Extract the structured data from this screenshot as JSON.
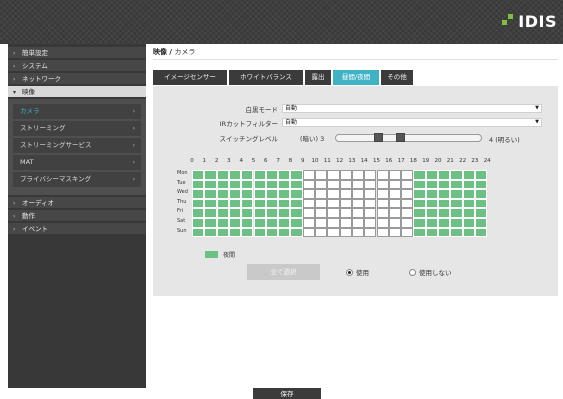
{
  "brand": {
    "logo_text": "IDIS"
  },
  "sidebar": {
    "items": [
      {
        "label": "簡単設定"
      },
      {
        "label": "システム"
      },
      {
        "label": "ネットワーク"
      },
      {
        "label": "映像"
      },
      {
        "label": "オーディオ"
      },
      {
        "label": "動作"
      },
      {
        "label": "イベント"
      }
    ],
    "submenu": [
      {
        "label": "カメラ"
      },
      {
        "label": "ストリーミング"
      },
      {
        "label": "ストリーミングサービス"
      },
      {
        "label": "MAT"
      },
      {
        "label": "プライバシーマスキング"
      }
    ]
  },
  "breadcrumb": {
    "section": "映像 / ",
    "current": "カメラ"
  },
  "tabs": [
    {
      "label": "イメージセンサー"
    },
    {
      "label": "ホワイトバランス"
    },
    {
      "label": "露出"
    },
    {
      "label": "昼間/夜間"
    },
    {
      "label": "その他"
    }
  ],
  "form": {
    "mode_label": "白黒モード",
    "mode_value": "自動",
    "ircut_label": "IRカットフィルター",
    "ircut_value": "自動",
    "switch_label": "スイッチングレベル",
    "dark_label": "(暗い) 3",
    "bright_label": "4 (明るい)",
    "switch_level_low": 3,
    "switch_level_high": 4
  },
  "schedule": {
    "hours": [
      "0",
      "1",
      "2",
      "3",
      "4",
      "5",
      "6",
      "7",
      "8",
      "9",
      "10",
      "11",
      "12",
      "13",
      "14",
      "15",
      "16",
      "17",
      "18",
      "19",
      "20",
      "21",
      "22",
      "23",
      "24"
    ],
    "days": [
      "Mon",
      "Tue",
      "Wed",
      "Thu",
      "Fri",
      "Sat",
      "Sun"
    ],
    "night_hours": [
      0,
      1,
      2,
      3,
      4,
      5,
      6,
      7,
      8,
      18,
      19,
      20,
      21,
      22,
      23
    ],
    "legend_label": "夜間",
    "select_all_label": "全て選択",
    "use_label": "使用",
    "not_use_label": "使用しない",
    "use_selected": true
  },
  "footer": {
    "save_label": "保存"
  },
  "colors": {
    "accent": "#3fb2c6",
    "night": "#6cc083"
  }
}
